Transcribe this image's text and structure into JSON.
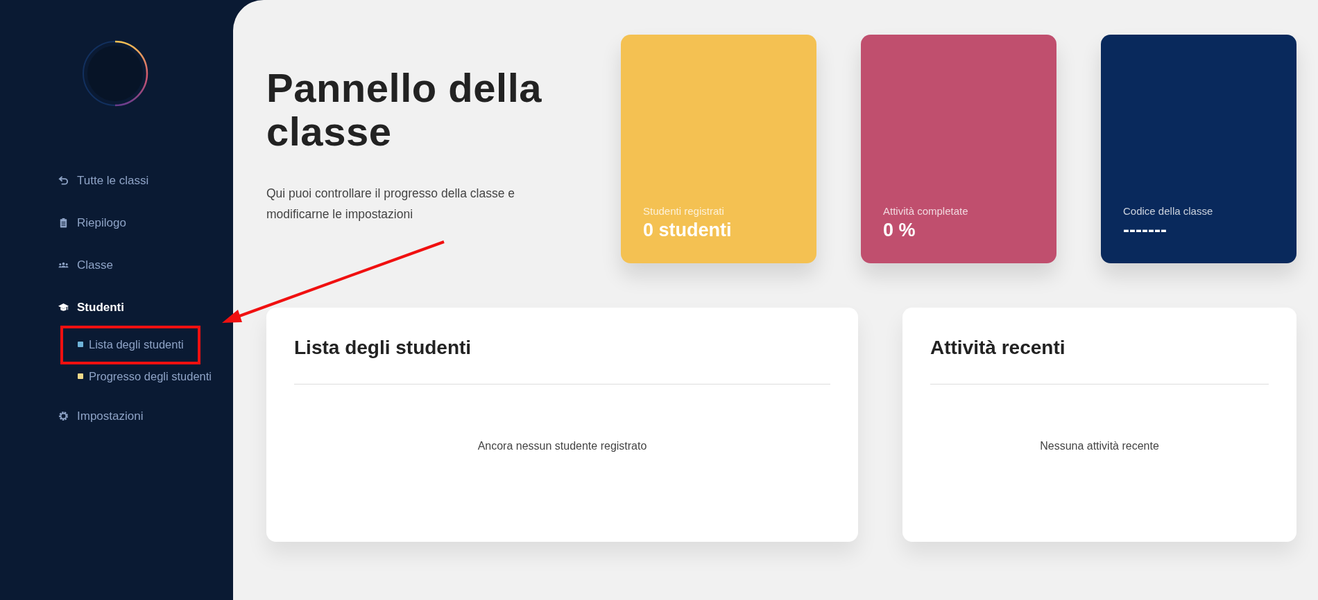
{
  "sidebar": {
    "menu": [
      {
        "label": "Tutte le classi",
        "kind": "back",
        "selected": false
      },
      {
        "label": "Riepilogo",
        "kind": "clipboard",
        "selected": false
      },
      {
        "label": "Classe",
        "kind": "group",
        "selected": false
      },
      {
        "label": "Studenti",
        "kind": "cap",
        "selected": true,
        "children": [
          {
            "label": "Lista degli studenti",
            "color": "#6fb3d9"
          },
          {
            "label": "Progresso degli studenti",
            "color": "#f0d98a"
          }
        ]
      },
      {
        "label": "Impostazioni",
        "kind": "gear",
        "selected": false
      }
    ]
  },
  "header": {
    "title": "Pannello della classe",
    "subtitle": "Qui puoi controllare il progresso della classe e modificarne le impostazioni"
  },
  "stats": [
    {
      "label": "Studenti registrati",
      "value": "0 studenti",
      "color": "#f4c152"
    },
    {
      "label": "Attività completate",
      "value": "0 %",
      "color": "#c04f6e"
    },
    {
      "label": "Codice della classe",
      "value": "-------",
      "color": "#09295c"
    }
  ],
  "panels": [
    {
      "title": "Lista degli studenti",
      "empty_text": "Ancora nessun studente registrato"
    },
    {
      "title": "Attività recenti",
      "empty_text": "Nessuna attività recente"
    }
  ]
}
